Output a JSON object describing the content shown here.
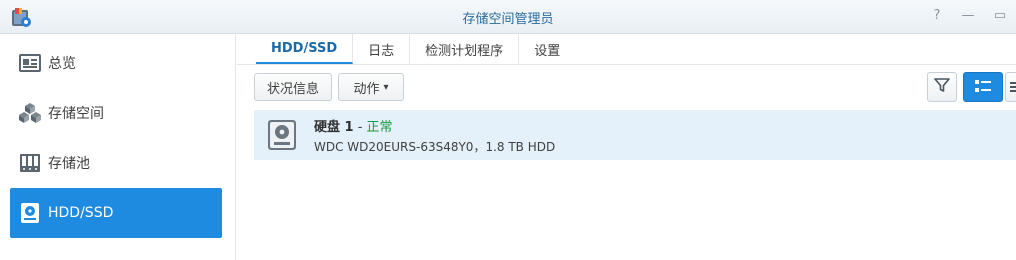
{
  "window": {
    "title": "存储空间管理员",
    "controls": {
      "help": "?",
      "minimize": "—",
      "maximize": "▭"
    }
  },
  "sidebar": {
    "items": [
      {
        "label": "总览",
        "icon": "overview-icon",
        "active": false
      },
      {
        "label": "存储空间",
        "icon": "volume-cubes-icon",
        "active": false
      },
      {
        "label": "存储池",
        "icon": "storage-pool-icon",
        "active": false
      },
      {
        "label": "HDD/SSD",
        "icon": "hdd-icon",
        "active": true
      }
    ]
  },
  "tabs": [
    {
      "label": "HDD/SSD",
      "active": true
    },
    {
      "label": "日志",
      "active": false
    },
    {
      "label": "检测计划程序",
      "active": false
    },
    {
      "label": "设置",
      "active": false
    }
  ],
  "toolbar": {
    "status_info_label": "状况信息",
    "action_label": "动作",
    "action_caret": "▾"
  },
  "disks": [
    {
      "name": "硬盘 1",
      "separator": " - ",
      "status": "正常",
      "detail": "WDC WD20EURS-63S48Y0，1.8 TB HDD"
    }
  ],
  "colors": {
    "accent": "#1e8ae0",
    "status_ok": "#1a9a3c",
    "row_selected": "#e4f1fa"
  }
}
